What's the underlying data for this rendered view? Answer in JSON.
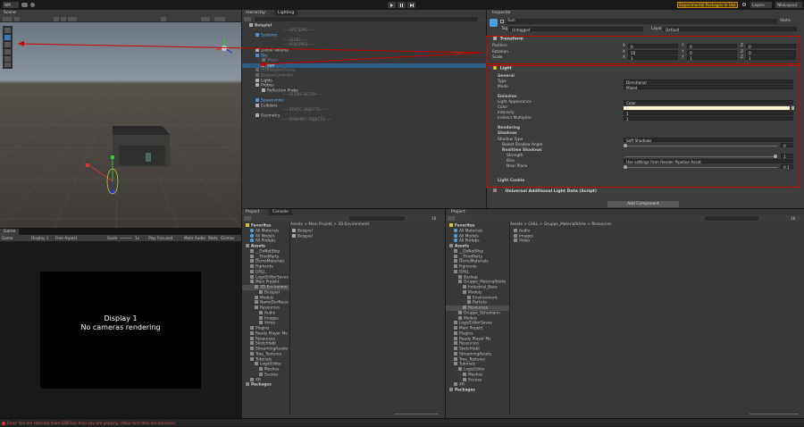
{
  "toolbar": {
    "account": "NM",
    "play_icons": [
      "play-icon",
      "pause-icon",
      "step-icon"
    ],
    "experimental_label": "Experimental Packages In Use",
    "layers_label": "Layers",
    "layout_label": "NiloLayout"
  },
  "scene_panel": {
    "tab": "Scene"
  },
  "game_panel": {
    "tab": "Game",
    "mode": "Game",
    "display": "Display 1",
    "aspect": "Free Aspect",
    "scale_label": "Scale",
    "scale_value": "1x",
    "play_focused": "Play Focused",
    "mute_audio": "Mute Audio",
    "stats": "Stats",
    "gizmos": "Gizmos",
    "viewport_line1": "Display 1",
    "viewport_line2": "No cameras rendering"
  },
  "hierarchy": {
    "tabs": [
      "Hierarchy",
      "Lighting"
    ],
    "items": [
      {
        "label": "Beispiel",
        "depth": 0,
        "kind": "scene"
      },
      {
        "label": "-----SYSTEMS-----",
        "depth": 1,
        "kind": "header"
      },
      {
        "label": "Systems",
        "depth": 1,
        "kind": "blue"
      },
      {
        "label": "-----LEVEL-----",
        "depth": 1,
        "kind": "header"
      },
      {
        "label": "-----VOLUMES-----",
        "depth": 1,
        "kind": "header"
      },
      {
        "label": "Global Volume",
        "depth": 1,
        "kind": "go"
      },
      {
        "label": "Sky",
        "depth": 1,
        "kind": "blue"
      },
      {
        "label": "Moon",
        "depth": 2,
        "kind": "dim"
      },
      {
        "label": "Sun",
        "depth": 2,
        "kind": "selected"
      },
      {
        "label": "HDRISkyboxSetup",
        "depth": 1,
        "kind": "dim"
      },
      {
        "label": "SkyboxController",
        "depth": 1,
        "kind": "dim"
      },
      {
        "label": "Lights",
        "depth": 1,
        "kind": "go"
      },
      {
        "label": "Probes",
        "depth": 1,
        "kind": "go"
      },
      {
        "label": "Reflection Probe",
        "depth": 2,
        "kind": "go"
      },
      {
        "label": "-----SCENE SETUP-----",
        "depth": 1,
        "kind": "header"
      },
      {
        "label": "Spawnables",
        "depth": 1,
        "kind": "blue"
      },
      {
        "label": "Colliders",
        "depth": 1,
        "kind": "go"
      },
      {
        "label": "-----STATIC OBJECTS-----",
        "depth": 1,
        "kind": "header"
      },
      {
        "label": "Geometry",
        "depth": 1,
        "kind": "go"
      },
      {
        "label": "-----DYNAMIC OBJECTS-----",
        "depth": 1,
        "kind": "header"
      }
    ]
  },
  "inspector": {
    "tab": "Inspector",
    "object_name": "Sun",
    "static_label": "Static",
    "tag_label": "Tag",
    "tag_value": "Untagged",
    "layer_label": "Layer",
    "layer_value": "Default",
    "transform": {
      "title": "Transform",
      "rows": [
        {
          "label": "Position",
          "x": "0",
          "y": "0",
          "z": "0"
        },
        {
          "label": "Rotation",
          "x": "50",
          "y": "0",
          "z": "0"
        },
        {
          "label": "Scale",
          "x": "1",
          "y": "1",
          "z": "1"
        }
      ]
    },
    "light": {
      "title": "Light",
      "general": "General",
      "type_label": "Type",
      "type_value": "Directional",
      "mode_label": "Mode",
      "mode_value": "Mixed",
      "emission": "Emission",
      "appearance_label": "Light Appearance",
      "appearance_value": "Color",
      "color_label": "Color",
      "color_value": "#fff4d6",
      "intensity_label": "Intensity",
      "intensity_value": "1",
      "indirect_label": "Indirect Multiplier",
      "indirect_value": "1",
      "rendering": "Rendering",
      "shadows": "Shadows",
      "shadow_type_label": "Shadow Type",
      "shadow_type_value": "Soft Shadows",
      "baked_angle_label": "Baked Shadow Angle",
      "baked_angle_value": "0",
      "realtime": "Realtime Shadows",
      "strength_label": "Strength",
      "strength_value": "1",
      "bias_label": "Bias",
      "bias_value": "Use settings from Render Pipeline Asset",
      "near_label": "Near Plane",
      "near_value": "0.1",
      "cookie": "Light Cookie"
    },
    "additional": "Universal Additional Light Data (Script)",
    "add_component": "Add Component"
  },
  "project_left": {
    "tabs": [
      "Project",
      "Console"
    ],
    "breadcrumb": [
      "Assets",
      "Main Projekt",
      "3D-Environment"
    ],
    "count": "18",
    "files": [
      "Beispiel",
      "Beispiel"
    ],
    "tree": [
      {
        "label": "Favorites",
        "depth": 0,
        "bold": true
      },
      {
        "label": "All Materials",
        "depth": 1
      },
      {
        "label": "All Models",
        "depth": 1
      },
      {
        "label": "All Prefabs",
        "depth": 1
      },
      {
        "label": "Assets",
        "depth": 0,
        "bold": true
      },
      {
        "label": "__DoNotShip",
        "depth": 1
      },
      {
        "label": "__ThirdParty",
        "depth": 1
      },
      {
        "label": "DemoMaterials",
        "depth": 1
      },
      {
        "label": "Figments",
        "depth": 1
      },
      {
        "label": "GHLL",
        "depth": 1
      },
      {
        "label": "LogicEditorSaves",
        "depth": 1
      },
      {
        "label": "Main Projekt",
        "depth": 1
      },
      {
        "label": "3D-Environme",
        "depth": 2,
        "sel": true
      },
      {
        "label": "Beispiel",
        "depth": 3
      },
      {
        "label": "Models",
        "depth": 2
      },
      {
        "label": "NameDerNeue",
        "depth": 2
      },
      {
        "label": "Resources",
        "depth": 2
      },
      {
        "label": "Audio",
        "depth": 3
      },
      {
        "label": "Images",
        "depth": 3
      },
      {
        "label": "Video",
        "depth": 3
      },
      {
        "label": "Plugins",
        "depth": 1
      },
      {
        "label": "Ready Player Me",
        "depth": 1
      },
      {
        "label": "Resources",
        "depth": 1
      },
      {
        "label": "SketchfabI",
        "depth": 1
      },
      {
        "label": "StreamingAssets",
        "depth": 1
      },
      {
        "label": "Tree_Textures",
        "depth": 1
      },
      {
        "label": "Tutorials",
        "depth": 1
      },
      {
        "label": "LogicEditor",
        "depth": 2
      },
      {
        "label": "Meshes",
        "depth": 3
      },
      {
        "label": "Scenes",
        "depth": 3
      },
      {
        "label": "XR",
        "depth": 1
      },
      {
        "label": "Packages",
        "depth": 0,
        "bold": true
      }
    ]
  },
  "project_right": {
    "tab": "Project",
    "breadcrumb": [
      "Assets",
      "GHLL",
      "Gruppe_Materialhärte",
      "Resources"
    ],
    "count": "18",
    "files": [
      "Audio",
      "Images",
      "Video"
    ],
    "tree": [
      {
        "label": "Favorites",
        "depth": 0,
        "bold": true
      },
      {
        "label": "All Materials",
        "depth": 1
      },
      {
        "label": "All Models",
        "depth": 1
      },
      {
        "label": "All Prefabs",
        "depth": 1
      },
      {
        "label": "Assets",
        "depth": 0,
        "bold": true
      },
      {
        "label": "__DoNotShip",
        "depth": 1
      },
      {
        "label": "__ThirdParty",
        "depth": 1
      },
      {
        "label": "DemoMaterials",
        "depth": 1
      },
      {
        "label": "Figments",
        "depth": 1
      },
      {
        "label": "GHLL",
        "depth": 1
      },
      {
        "label": "Backup",
        "depth": 2
      },
      {
        "label": "Gruppe_Materialhärte",
        "depth": 2
      },
      {
        "label": "Industrial_Base",
        "depth": 3
      },
      {
        "label": "Models",
        "depth": 3
      },
      {
        "label": "Environment",
        "depth": 4
      },
      {
        "label": "Particle",
        "depth": 4
      },
      {
        "label": "Resources",
        "depth": 3,
        "sel": true
      },
      {
        "label": "Gruppe_Schumann",
        "depth": 2
      },
      {
        "label": "Models",
        "depth": 2
      },
      {
        "label": "LogicEditorSaves",
        "depth": 1
      },
      {
        "label": "Main Projekt",
        "depth": 1
      },
      {
        "label": "Plugins",
        "depth": 1
      },
      {
        "label": "Ready Player Me",
        "depth": 1
      },
      {
        "label": "Resources",
        "depth": 1
      },
      {
        "label": "SketchfabI",
        "depth": 1
      },
      {
        "label": "StreamingAssets",
        "depth": 1
      },
      {
        "label": "Tree_Textures",
        "depth": 1
      },
      {
        "label": "Tutorials",
        "depth": 1
      },
      {
        "label": "LogicEditor",
        "depth": 2
      },
      {
        "label": "Meshes",
        "depth": 3
      },
      {
        "label": "Scenes",
        "depth": 3
      },
      {
        "label": "XR",
        "depth": 1
      },
      {
        "label": "Packages",
        "depth": 0,
        "bold": true
      }
    ]
  },
  "status_bar": {
    "message": "Error: You are stacking more GUIClips than you are popping. Make sure they are balanced."
  }
}
